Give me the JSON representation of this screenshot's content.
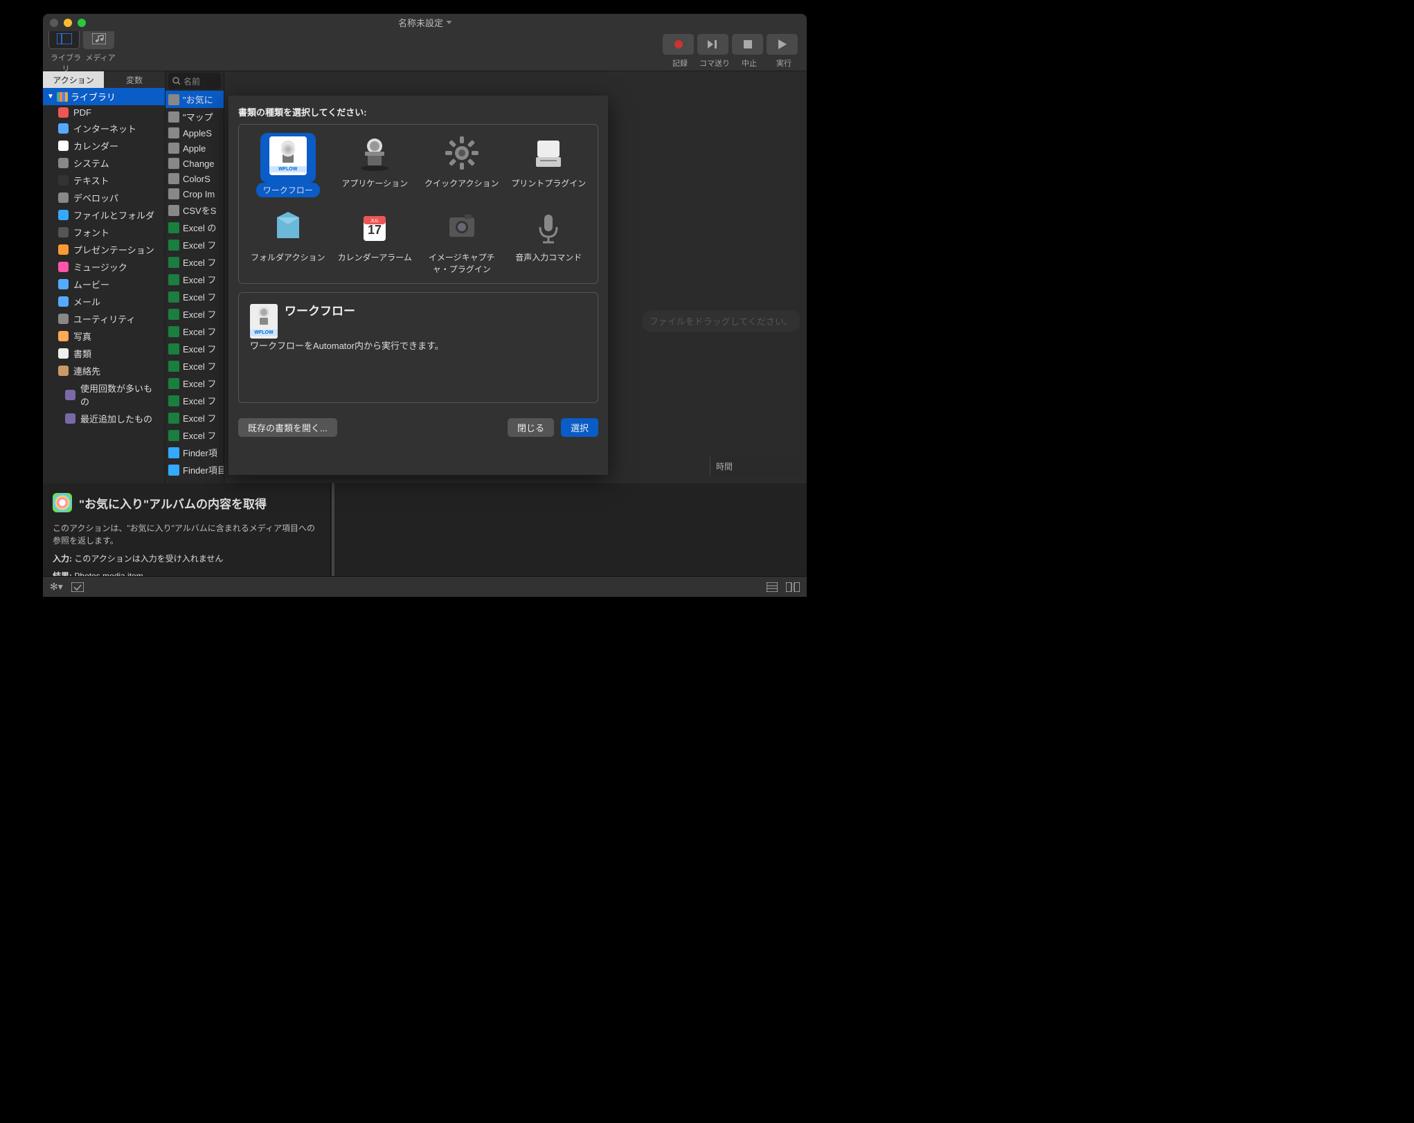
{
  "window": {
    "title": "名称未設定"
  },
  "toolbar": {
    "library": "ライブラリ",
    "media": "メディア",
    "record": "記録",
    "step": "コマ送り",
    "stop": "中止",
    "run": "実行"
  },
  "sidebar": {
    "tabs": {
      "actions": "アクション",
      "variables": "変数"
    },
    "search_placeholder": "名前",
    "library_header": "ライブラリ",
    "items": [
      {
        "label": "PDF",
        "icon": "pdf-icon"
      },
      {
        "label": "インターネット",
        "icon": "globe-icon"
      },
      {
        "label": "カレンダー",
        "icon": "calendar-icon"
      },
      {
        "label": "システム",
        "icon": "gear-icon"
      },
      {
        "label": "テキスト",
        "icon": "text-icon"
      },
      {
        "label": "デベロッパ",
        "icon": "tools-icon"
      },
      {
        "label": "ファイルとフォルダ",
        "icon": "finder-icon"
      },
      {
        "label": "フォント",
        "icon": "font-icon"
      },
      {
        "label": "プレゼンテーション",
        "icon": "presentation-icon"
      },
      {
        "label": "ミュージック",
        "icon": "music-icon"
      },
      {
        "label": "ムービー",
        "icon": "movie-icon"
      },
      {
        "label": "メール",
        "icon": "mail-icon"
      },
      {
        "label": "ユーティリティ",
        "icon": "wrench-icon"
      },
      {
        "label": "写真",
        "icon": "photos-icon"
      },
      {
        "label": "書類",
        "icon": "document-icon"
      },
      {
        "label": "連絡先",
        "icon": "contacts-icon"
      }
    ],
    "smart": [
      {
        "label": "使用回数が多いもの",
        "icon": "smart-icon"
      },
      {
        "label": "最近追加したもの",
        "icon": "smart-icon"
      }
    ]
  },
  "actions": [
    "\"お気に",
    "\"マップ",
    "AppleS",
    "Apple",
    "Change",
    "ColorS",
    "Crop Im",
    "CSVをS",
    "Excel の",
    "Excel フ",
    "Excel フ",
    "Excel フ",
    "Excel フ",
    "Excel フ",
    "Excel フ",
    "Excel フ",
    "Excel フ",
    "Excel フ",
    "Excel フ",
    "Excel フ",
    "Excel フ",
    "Finder項",
    "Finder項目のSp...tコメントを設定"
  ],
  "main": {
    "drop_hint": "ファイルをドラッグしてください。",
    "time_header": "時間"
  },
  "description": {
    "title": "\"お気に入り\"アルバムの内容を取得",
    "text": "このアクションは、\"お気に入り\"アルバムに含まれるメディア項目への参照を返します。",
    "input_label": "入力:",
    "input_value": "このアクションは入力を受け入れません",
    "result_label": "結果:",
    "result_value": "Photos media item"
  },
  "sheet": {
    "title": "書類の種類を選択してください:",
    "types": [
      {
        "label": "ワークフロー",
        "selected": true
      },
      {
        "label": "アプリケーション",
        "selected": false
      },
      {
        "label": "クイックアクション",
        "selected": false
      },
      {
        "label": "プリントプラグイン",
        "selected": false
      },
      {
        "label": "フォルダアクション",
        "selected": false
      },
      {
        "label": "カレンダーアラーム",
        "selected": false
      },
      {
        "label": "イメージキャプチャ・プラグイン",
        "selected": false
      },
      {
        "label": "音声入力コマンド",
        "selected": false
      }
    ],
    "detail": {
      "title": "ワークフロー",
      "text": "ワークフローをAutomator内から実行できます。",
      "wflow_badge": "WFLOW"
    },
    "buttons": {
      "open_existing": "既存の書類を開く...",
      "close": "閉じる",
      "choose": "選択"
    }
  }
}
